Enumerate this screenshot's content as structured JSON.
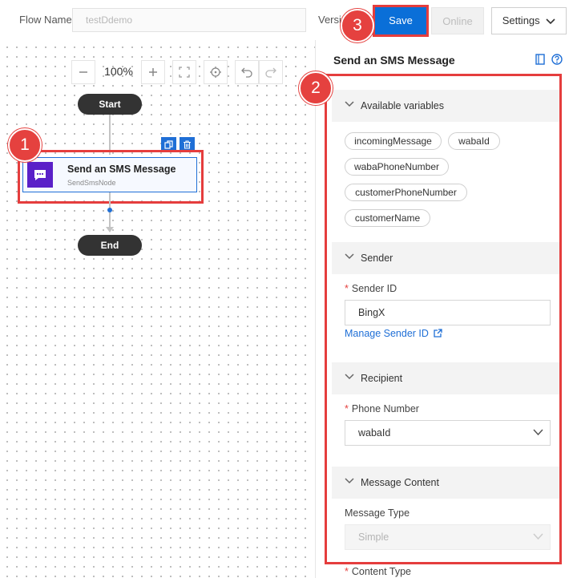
{
  "header": {
    "flow_name_label": "Flow Name",
    "flow_name_value": "testDdemo",
    "version_label": "Version",
    "save_label": "Save",
    "online_label": "Online",
    "settings_label": "Settings"
  },
  "canvas": {
    "zoom": "100%",
    "start_label": "Start",
    "end_label": "End",
    "node": {
      "title": "Send an SMS Message",
      "subtitle": "SendSmsNode"
    }
  },
  "callouts": [
    "1",
    "2",
    "3"
  ],
  "panel": {
    "title": "Send an SMS Message",
    "variables_section": "Available variables",
    "variables": [
      "incomingMessage",
      "wabaId",
      "wabaPhoneNumber",
      "customerPhoneNumber",
      "customerName"
    ],
    "sender_section": "Sender",
    "sender_id_label": "Sender ID",
    "sender_id_value": "BingX",
    "manage_sender_link": "Manage Sender ID",
    "recipient_section": "Recipient",
    "phone_label": "Phone Number",
    "phone_value": "wabaId",
    "content_section": "Message Content",
    "message_type_label": "Message Type",
    "message_type_value": "Simple",
    "content_type_label": "Content Type"
  },
  "colors": {
    "accent": "#0a6fd8",
    "callout": "#e5413f",
    "node_icon": "#5a20c8"
  }
}
